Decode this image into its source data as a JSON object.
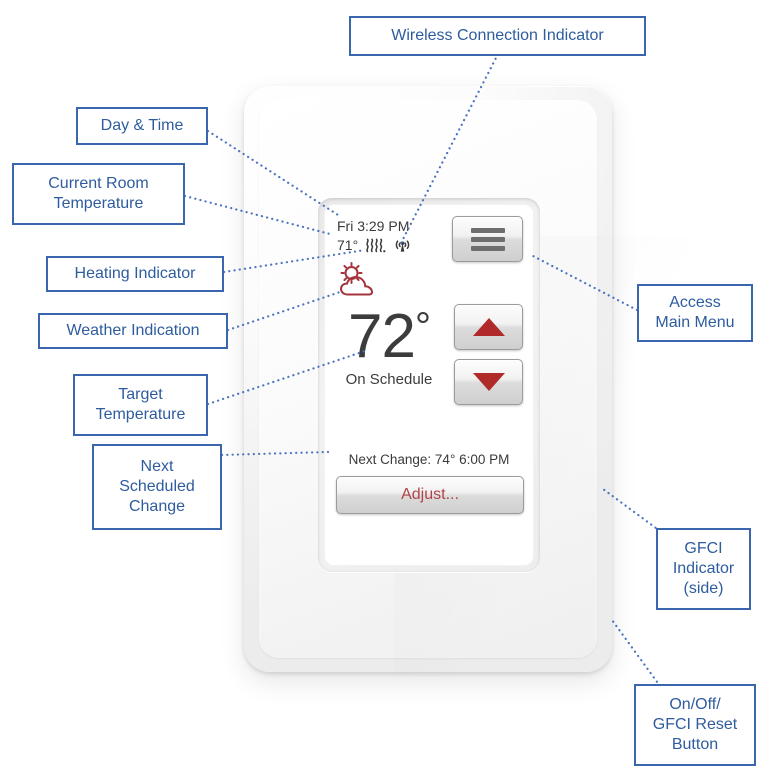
{
  "diagram": {
    "title": "Thermostat home screen callout diagram"
  },
  "device_screen": {
    "day_time": "Fri 3:29 PM",
    "room_temperature": "71°",
    "heating_indicator_icon": "heat-waves-icon",
    "wireless_indicator_icon": "wireless-antenna-icon",
    "weather_icon": "sun-behind-cloud-icon",
    "target_temperature": "72",
    "target_degree_symbol": "°",
    "schedule_status": "On Schedule",
    "next_change": "Next Change: 74°  6:00 PM",
    "adjust_label": "Adjust...",
    "menu_button_icon": "hamburger-menu-icon",
    "up_button_icon": "triangle-up-icon",
    "down_button_icon": "triangle-down-icon"
  },
  "callouts": {
    "wireless": "Wireless Connection Indicator",
    "day_time": "Day & Time",
    "room_temp": "Current Room\nTemperature",
    "heating": "Heating Indicator",
    "weather": "Weather Indication",
    "target_temp": "Target\nTemperature",
    "next_change": "Next\nScheduled\nChange",
    "access_menu": "Access\nMain Menu",
    "gfci_indicator": "GFCI\nIndicator\n(side)",
    "onoff_reset": "On/Off/\nGFCI Reset\nButton"
  },
  "colors": {
    "callout_border": "#3a66ad",
    "callout_text": "#2e5c9e",
    "leader_line": "#4a74bd",
    "accent_red": "#b02a2a",
    "weather_red": "#a5343c",
    "adjust_text": "#b0444a",
    "screen_text": "#3a3a3a"
  }
}
